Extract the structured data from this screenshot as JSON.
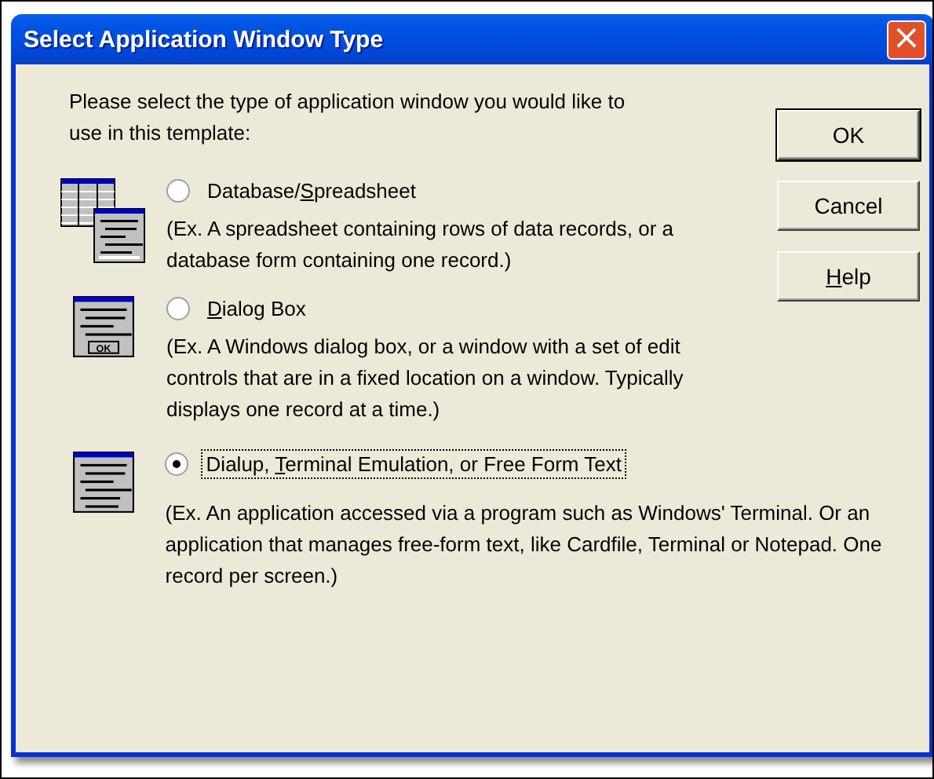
{
  "window": {
    "title": "Select Application Window Type",
    "close": "×"
  },
  "intro": "Please select the type of application window you would like to use in this template:",
  "options": [
    {
      "kind": "spreadsheet",
      "label": {
        "pre": "Database/",
        "key": "S",
        "post": "preadsheet"
      },
      "selected": false,
      "focused": false,
      "description": "(Ex. A spreadsheet containing rows of data records, or a database form containing one record.)"
    },
    {
      "kind": "dialog",
      "label": {
        "key": "D",
        "post": "ialog Box"
      },
      "selected": false,
      "focused": false,
      "description": "(Ex. A Windows dialog box, or a window with a set of edit controls that are in a fixed location on a window. Typically displays one record at a time.)",
      "icon_text": "OK"
    },
    {
      "kind": "text",
      "label": {
        "pre": "Dialup, ",
        "key": "T",
        "post": "erminal Emulation, or Free Form Text"
      },
      "selected": true,
      "focused": true,
      "description": "(Ex. An application accessed via a program such as Windows' Terminal. Or an application that manages free-form text, like Cardfile, Terminal or Notepad. One record per screen.)"
    }
  ],
  "buttons": [
    {
      "label": {
        "post": "OK"
      }
    },
    {
      "label": {
        "post": "Cancel"
      }
    },
    {
      "label": {
        "key": "H",
        "post": "elp"
      }
    }
  ]
}
